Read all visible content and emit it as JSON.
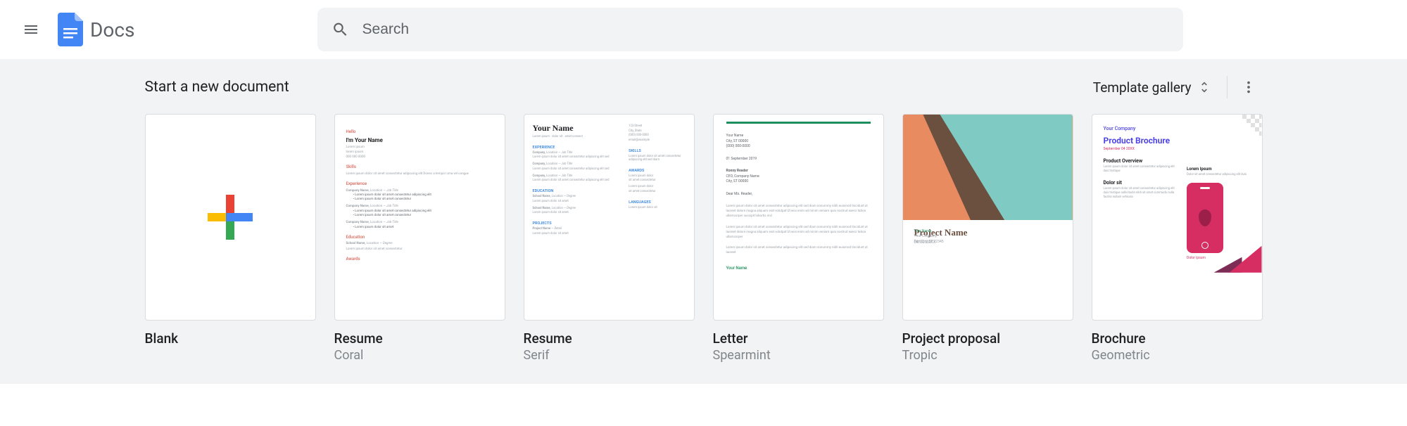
{
  "header": {
    "app_name": "Docs",
    "search_placeholder": "Search"
  },
  "templates": {
    "section_title": "Start a new document",
    "gallery_label": "Template gallery",
    "cards": [
      {
        "title": "Blank",
        "subtitle": ""
      },
      {
        "title": "Resume",
        "subtitle": "Coral"
      },
      {
        "title": "Resume",
        "subtitle": "Serif"
      },
      {
        "title": "Letter",
        "subtitle": "Spearmint"
      },
      {
        "title": "Project proposal",
        "subtitle": "Tropic"
      },
      {
        "title": "Brochure",
        "subtitle": "Geometric"
      }
    ]
  }
}
